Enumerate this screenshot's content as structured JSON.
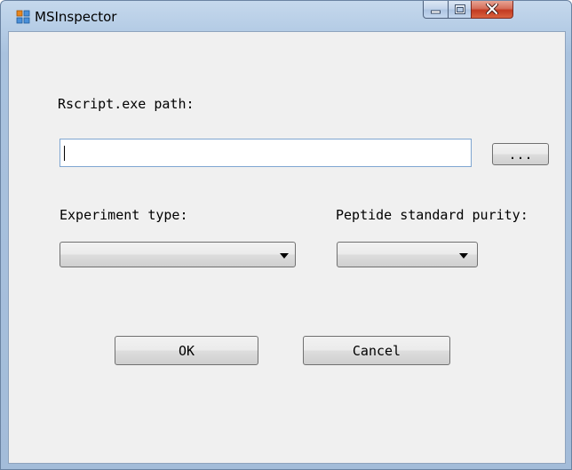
{
  "window": {
    "title": "MSInspector"
  },
  "rscript": {
    "label": "Rscript.exe path:",
    "value": "",
    "browse_label": "..."
  },
  "experiment": {
    "label": "Experiment type:",
    "selected": ""
  },
  "purity": {
    "label": "Peptide standard purity:",
    "selected": ""
  },
  "buttons": {
    "ok": "OK",
    "cancel": "Cancel"
  }
}
